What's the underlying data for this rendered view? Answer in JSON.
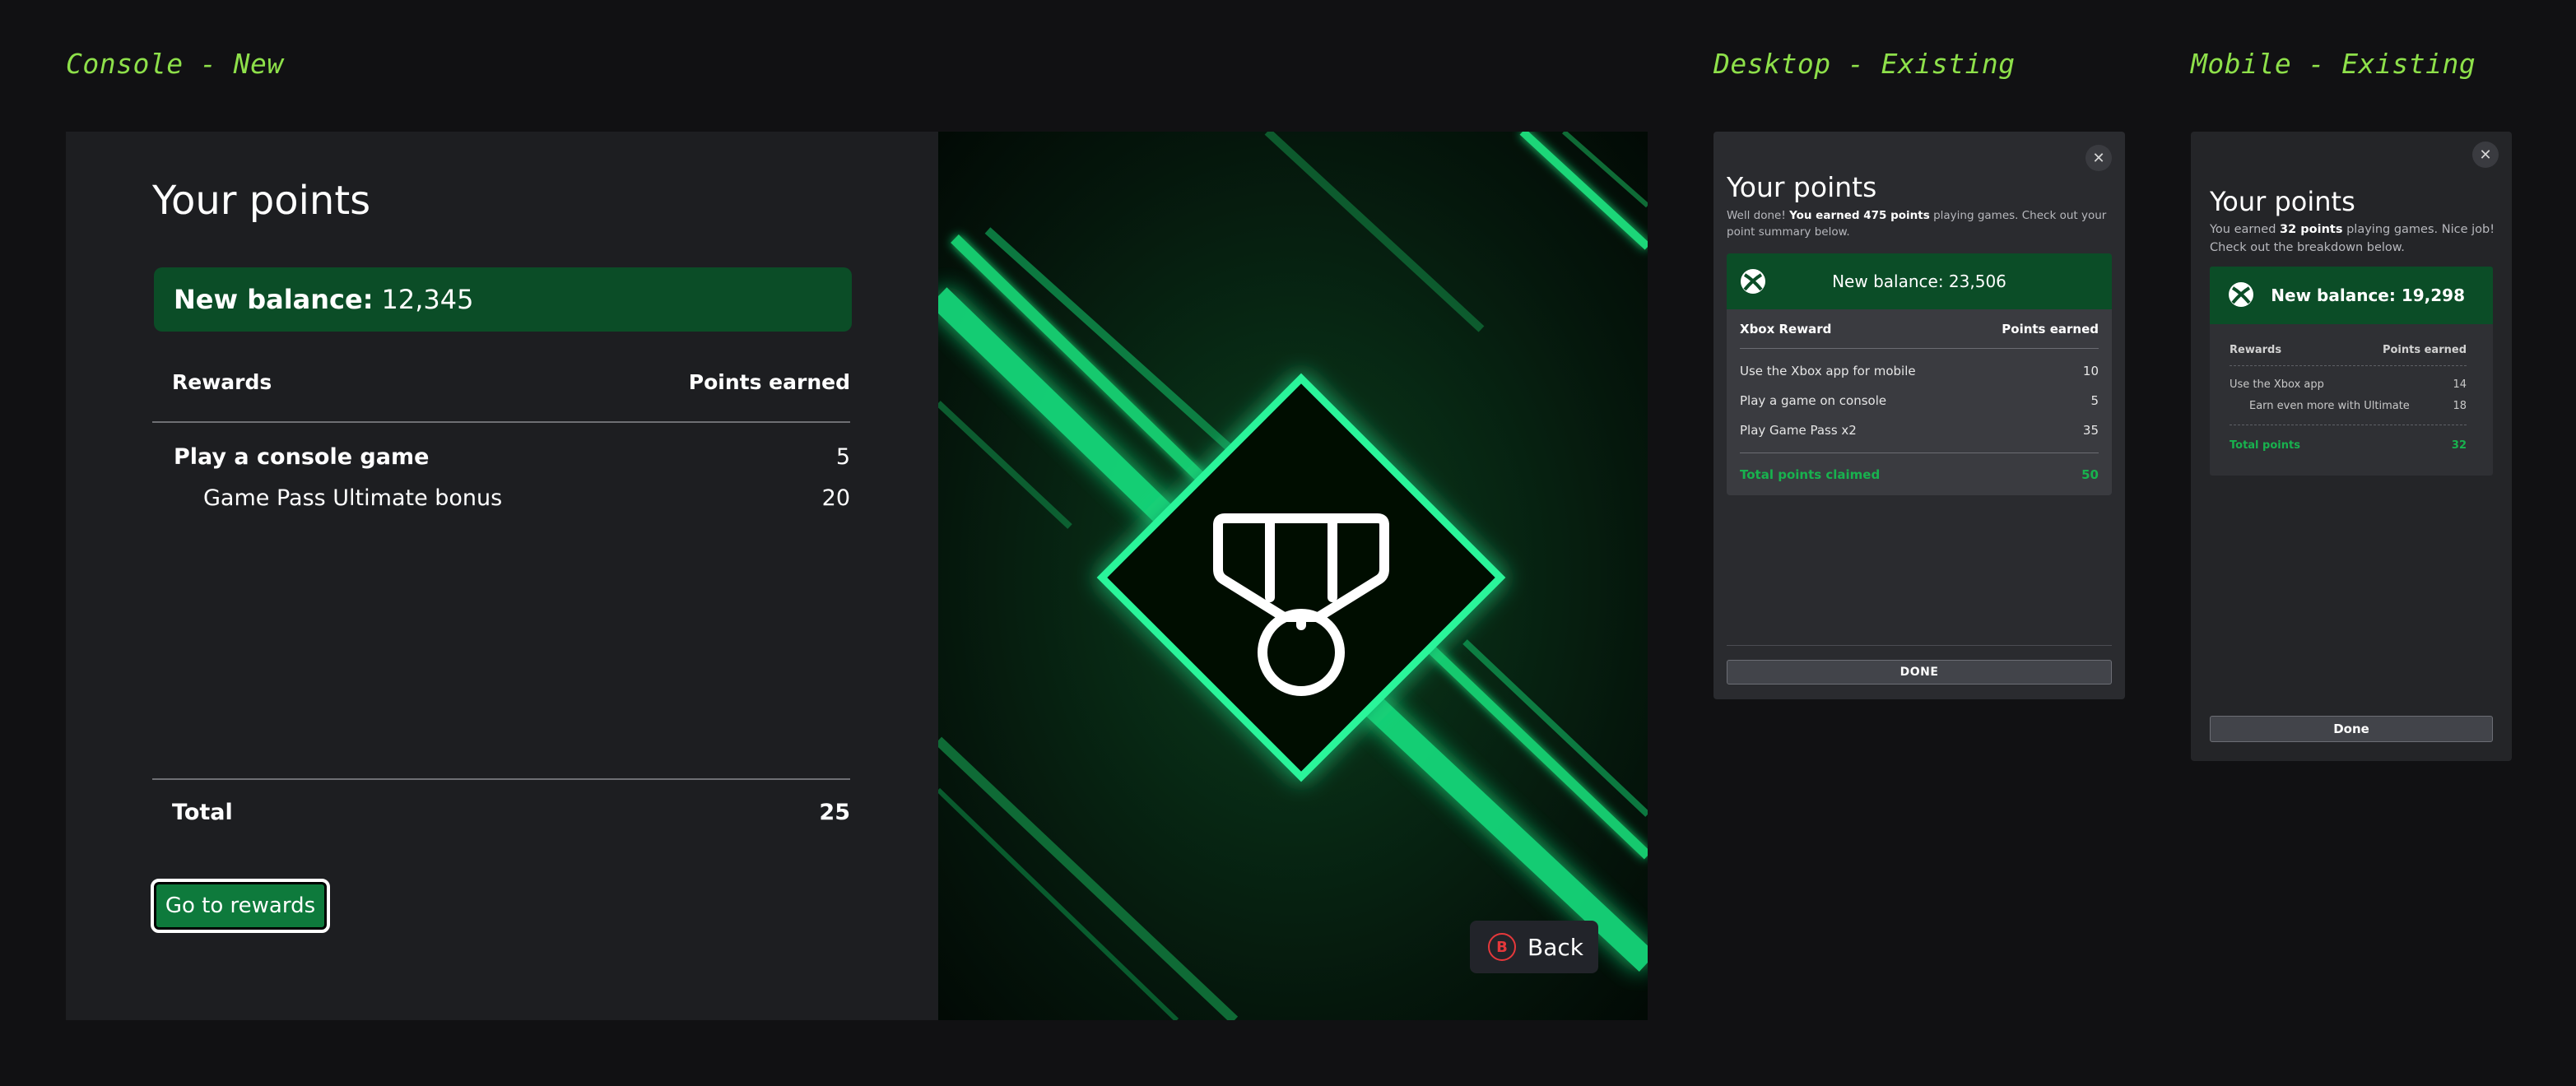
{
  "labels": {
    "console": "Console - New",
    "desktop": "Desktop - Existing",
    "mobile": "Mobile - Existing"
  },
  "console": {
    "title": "Your points",
    "balance_label": "New balance:",
    "balance_value": "12,345",
    "col_rewards": "Rewards",
    "col_points": "Points earned",
    "rows": [
      {
        "label": "Play a console game",
        "value": "5"
      },
      {
        "label": "Game Pass Ultimate bonus",
        "value": "20"
      }
    ],
    "total_label": "Total",
    "total_value": "25",
    "cta": "Go to rewards",
    "back_key": "B",
    "back_label": "Back"
  },
  "desktop": {
    "close": "✕",
    "title": "Your points",
    "sub_pre": "Well done! ",
    "sub_bold": "You earned 475 points",
    "sub_post": " playing games. Check out your point summary below.",
    "balance": "New balance: 23,506",
    "col_reward": "Xbox Reward",
    "col_points": "Points earned",
    "rows": [
      {
        "label": "Use the Xbox app for mobile",
        "value": "10"
      },
      {
        "label": "Play a game on console",
        "value": "5"
      },
      {
        "label": "Play Game Pass x2",
        "value": "35"
      }
    ],
    "total_label": "Total points claimed",
    "total_value": "50",
    "done": "DONE"
  },
  "mobile": {
    "close": "✕",
    "title": "Your points",
    "sub_pre": "You earned ",
    "sub_bold": "32 points",
    "sub_post": " playing games. Nice job! Check out the breakdown below.",
    "balance": "New balance: 19,298",
    "col_rewards": "Rewards",
    "col_points": "Points earned",
    "rows": [
      {
        "label": "Use the Xbox app",
        "value": "14"
      },
      {
        "label": "Earn even more with Ultimate",
        "value": "18"
      }
    ],
    "total_label": "Total points",
    "total_value": "32",
    "done": "Done"
  },
  "colors": {
    "accent_green": "#0b4d27",
    "cta_green": "#0e7a3c",
    "label_lime": "#8ee04a",
    "total_green": "#18b24e"
  }
}
